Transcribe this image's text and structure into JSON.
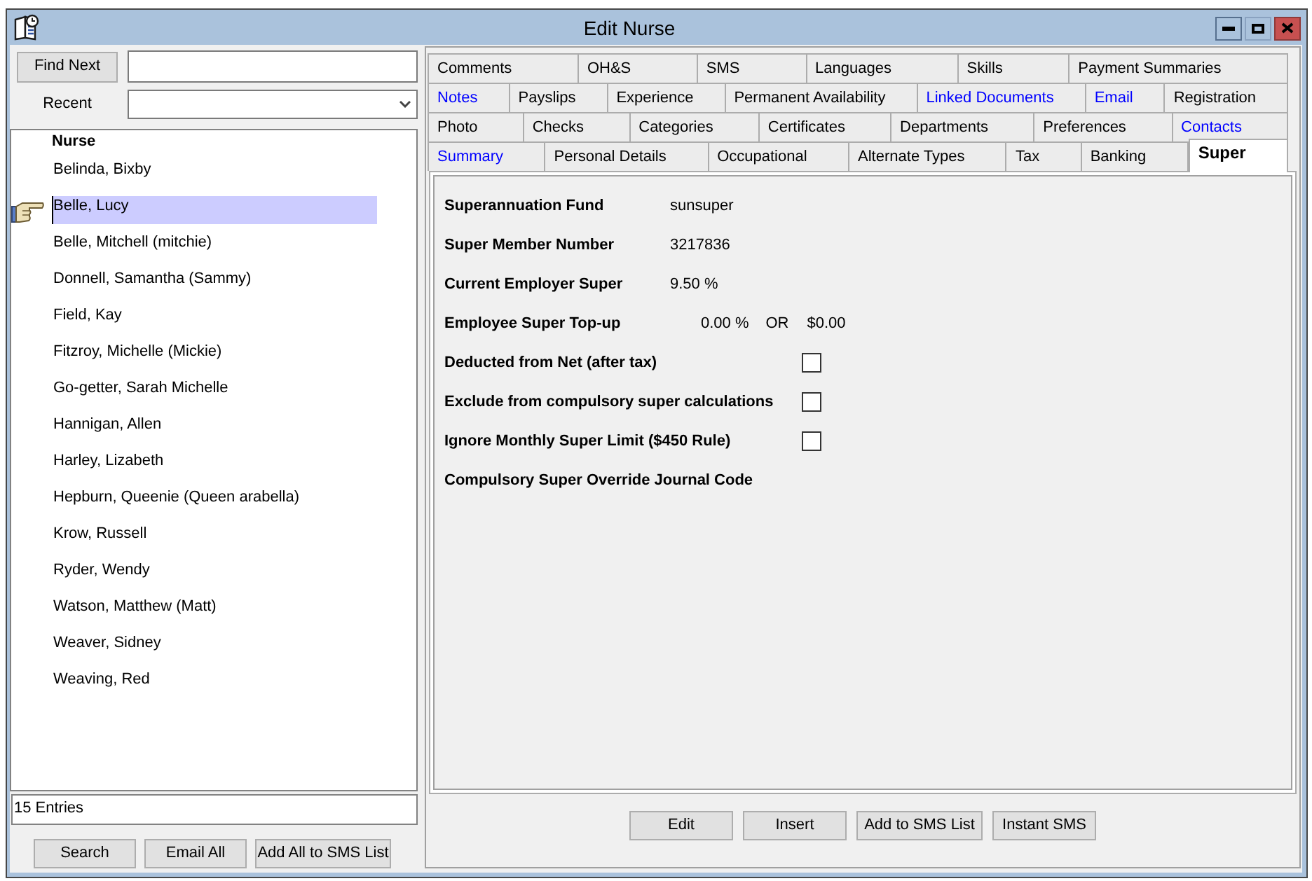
{
  "window": {
    "title": "Edit Nurse"
  },
  "search": {
    "button": "Find Next",
    "recent_label": "Recent"
  },
  "nurse_list": {
    "column": "Nurse",
    "rows": [
      {
        "name": "Belinda, Bixby",
        "selected": false
      },
      {
        "name": "Belle, Lucy",
        "selected": true
      },
      {
        "name": "Belle, Mitchell (mitchie)",
        "selected": false
      },
      {
        "name": "Donnell, Samantha (Sammy)",
        "selected": false
      },
      {
        "name": "Field, Kay",
        "selected": false
      },
      {
        "name": "Fitzroy, Michelle (Mickie)",
        "selected": false
      },
      {
        "name": "Go-getter, Sarah Michelle",
        "selected": false
      },
      {
        "name": "Hannigan, Allen",
        "selected": false
      },
      {
        "name": "Harley, Lizabeth",
        "selected": false
      },
      {
        "name": "Hepburn, Queenie (Queen arabella)",
        "selected": false
      },
      {
        "name": "Krow, Russell",
        "selected": false
      },
      {
        "name": "Ryder, Wendy",
        "selected": false
      },
      {
        "name": "Watson, Matthew (Matt)",
        "selected": false
      },
      {
        "name": "Weaver, Sidney",
        "selected": false
      },
      {
        "name": "Weaving, Red",
        "selected": false
      }
    ],
    "count": "15 Entries"
  },
  "list_buttons": [
    "Search",
    "Email All",
    "Add All to SMS List"
  ],
  "tab_rows": [
    [
      {
        "label": "Comments",
        "color": "#000000",
        "selected": false
      },
      {
        "label": "OH&S",
        "color": "#000000",
        "selected": false
      },
      {
        "label": "SMS",
        "color": "#000000",
        "selected": false
      },
      {
        "label": "Languages",
        "color": "#000000",
        "selected": false
      },
      {
        "label": "Skills",
        "color": "#000000",
        "selected": false
      },
      {
        "label": "Payment Summaries",
        "color": "#000000",
        "selected": false
      }
    ],
    [
      {
        "label": "Notes",
        "color": "#0000ff",
        "selected": false
      },
      {
        "label": "Payslips",
        "color": "#000000",
        "selected": false
      },
      {
        "label": "Experience",
        "color": "#000000",
        "selected": false
      },
      {
        "label": "Permanent Availability",
        "color": "#000000",
        "selected": false
      },
      {
        "label": "Linked Documents",
        "color": "#0000ff",
        "selected": false
      },
      {
        "label": "Email",
        "color": "#0000ff",
        "selected": false
      },
      {
        "label": "Registration",
        "color": "#000000",
        "selected": false
      }
    ],
    [
      {
        "label": "Photo",
        "color": "#000000",
        "selected": false
      },
      {
        "label": "Checks",
        "color": "#000000",
        "selected": false
      },
      {
        "label": "Categories",
        "color": "#000000",
        "selected": false
      },
      {
        "label": "Certificates",
        "color": "#000000",
        "selected": false
      },
      {
        "label": "Departments",
        "color": "#000000",
        "selected": false
      },
      {
        "label": "Preferences",
        "color": "#000000",
        "selected": false
      },
      {
        "label": "Contacts",
        "color": "#0000ff",
        "selected": false
      }
    ],
    [
      {
        "label": "Summary",
        "color": "#0000ff",
        "selected": false
      },
      {
        "label": "Personal Details",
        "color": "#000000",
        "selected": false
      },
      {
        "label": "Occupational",
        "color": "#000000",
        "selected": false
      },
      {
        "label": "Alternate Types",
        "color": "#000000",
        "selected": false
      },
      {
        "label": "Tax",
        "color": "#000000",
        "selected": false
      },
      {
        "label": "Banking",
        "color": "#000000",
        "selected": false
      },
      {
        "label": "Super",
        "color": "#000000",
        "selected": true
      }
    ]
  ],
  "fields": [
    {
      "kind": "text",
      "label": "Superannuation Fund",
      "value": "sunsuper"
    },
    {
      "kind": "text",
      "label": "Super Member Number",
      "value": "3217836"
    },
    {
      "kind": "text",
      "label": "Current Employer Super",
      "value": "9.50 %"
    },
    {
      "kind": "topup",
      "label": "Employee Super Top-up",
      "percent": "0.00 %",
      "conjunction": "OR",
      "amount": "$0.00"
    },
    {
      "kind": "checkbox",
      "label": "Deducted from Net (after tax)",
      "checked": false
    },
    {
      "kind": "checkbox",
      "label": "Exclude from compulsory super calculations",
      "checked": false
    },
    {
      "kind": "checkbox",
      "label": "Ignore Monthly Super Limit ($450 Rule)",
      "checked": false
    },
    {
      "kind": "label",
      "label": "Compulsory Super Override Journal Code"
    }
  ],
  "buttons": [
    "Edit",
    "Insert",
    "Add to SMS List",
    "Instant SMS"
  ]
}
